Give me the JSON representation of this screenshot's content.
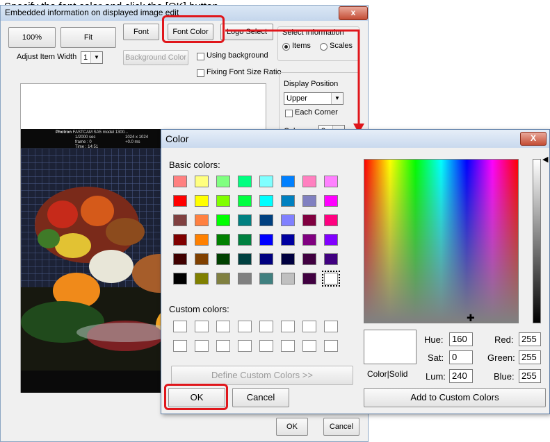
{
  "caption": "Specify the font color and click the [OK] button.",
  "main_window": {
    "title": "Embedded information on displayed image edit",
    "zoom_100_label": "100%",
    "fit_label": "Fit",
    "font_label": "Font",
    "font_color_label": "Font Color",
    "logo_select_label": "Logo Select",
    "adjust_item_width_label": "Adjust Item Width",
    "adjust_item_width_value": "1",
    "background_color_label": "Background Color",
    "using_background_label": "Using background",
    "fixing_font_size_ratio_label": "Fixing Font Size Ratio",
    "select_information_label": "Select Information",
    "items_label": "Items",
    "scales_label": "Scales",
    "display_position_label": "Display Position",
    "display_position_value": "Upper",
    "each_corner_label": "Each Corner",
    "columns_label": "Columns",
    "columns_value": "3",
    "ok_label": "OK",
    "cancel_label": "Cancel",
    "image_overlay": {
      "brand": "Photron",
      "model": "FASTCAM SA5 model 1300...",
      "rate": "1/2000 sec",
      "frame": "frame : 0",
      "time": "Time : 14:51",
      "resolution": "1024 x 1024",
      "offset": "+0.0 ms"
    }
  },
  "color_dialog": {
    "title": "Color",
    "close_label": "X",
    "basic_colors_label": "Basic colors:",
    "custom_colors_label": "Custom colors:",
    "define_custom_colors_label": "Define Custom Colors >>",
    "color_solid_label": "Color|Solid",
    "hue_label": "Hue:",
    "hue_value": "160",
    "sat_label": "Sat:",
    "sat_value": "0",
    "lum_label": "Lum:",
    "lum_value": "240",
    "red_label": "Red:",
    "red_value": "255",
    "green_label": "Green:",
    "green_value": "255",
    "blue_label": "Blue:",
    "blue_value": "255",
    "ok_label": "OK",
    "cancel_label": "Cancel",
    "add_to_custom_label": "Add to Custom Colors",
    "selected_color": "#ffffff",
    "basic_colors": [
      [
        "#ff8080",
        "#ffff80",
        "#80ff80",
        "#00ff80",
        "#80ffff",
        "#0080ff",
        "#ff80c0",
        "#ff80ff"
      ],
      [
        "#ff0000",
        "#ffff00",
        "#80ff00",
        "#00ff40",
        "#00ffff",
        "#0080c0",
        "#8080c0",
        "#ff00ff"
      ],
      [
        "#804040",
        "#ff8040",
        "#00ff00",
        "#008080",
        "#004080",
        "#8080ff",
        "#800040",
        "#ff0080"
      ],
      [
        "#800000",
        "#ff8000",
        "#008000",
        "#008040",
        "#0000ff",
        "#0000a0",
        "#800080",
        "#8000ff"
      ],
      [
        "#400000",
        "#804000",
        "#004000",
        "#004040",
        "#000080",
        "#000040",
        "#400040",
        "#400080"
      ],
      [
        "#000000",
        "#808000",
        "#808040",
        "#808080",
        "#408080",
        "#c0c0c0",
        "#400040",
        "#ffffff"
      ]
    ]
  },
  "accent_red": "#e0161b"
}
